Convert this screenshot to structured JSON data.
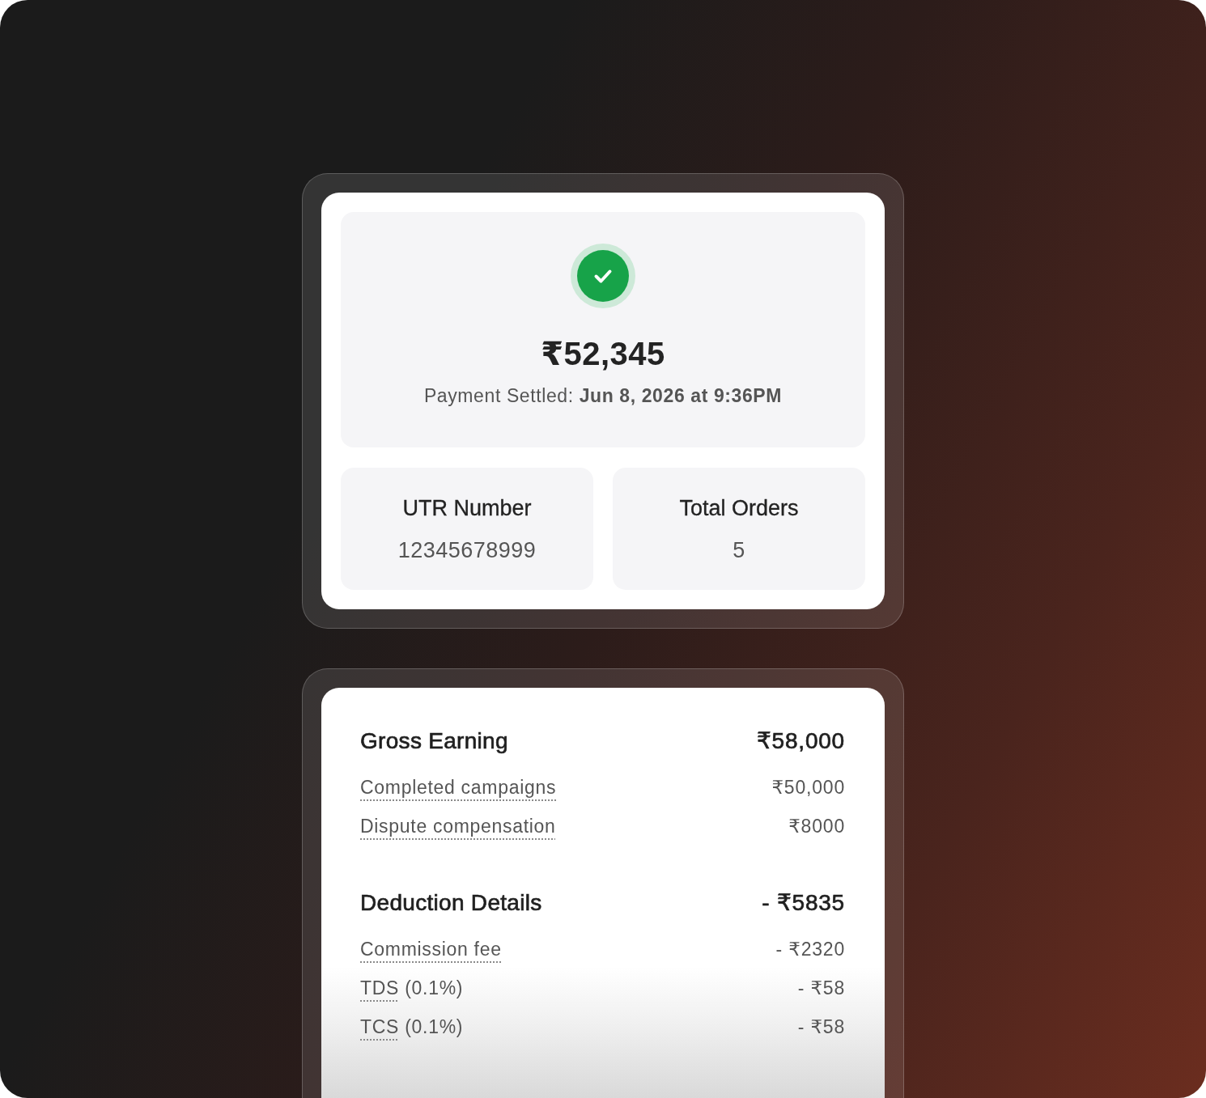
{
  "summary": {
    "success": true,
    "amount": "₹52,345",
    "settled": "Payment Settled: **Jun 8, 2026 at 9:36PM**"
  },
  "stats": [
    {
      "label": "UTR Number",
      "value": "12345678999"
    },
    {
      "label": "Total Orders",
      "value": "5"
    }
  ],
  "breakdown": [
    {
      "title": "Gross Earning",
      "total": "₹58,000",
      "items": [
        {
          "term": "Completed campaigns",
          "value": "₹50,000"
        },
        {
          "term": "Dispute compensation",
          "value": "₹8000"
        }
      ]
    },
    {
      "title": "Deduction Details",
      "total": "- ₹5835",
      "items": [
        {
          "term": "Commission fee",
          "value": "- ₹2320"
        },
        {
          "term": "TDS",
          "note": "(0.1%)",
          "value": "- ₹58"
        },
        {
          "term": "TCS",
          "note": "(0.1%)",
          "value": "- ₹58"
        }
      ]
    }
  ]
}
